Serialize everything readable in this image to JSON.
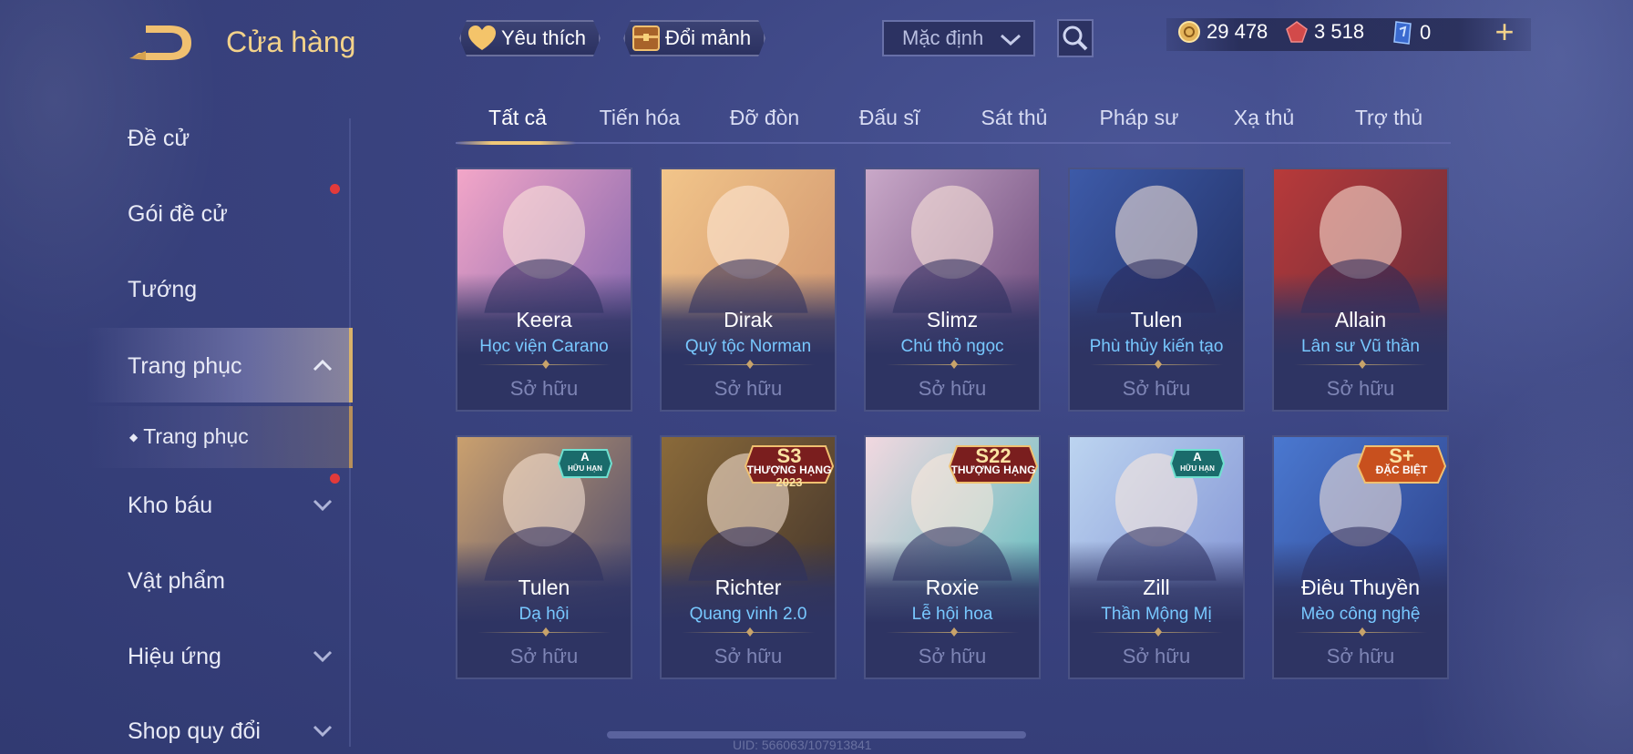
{
  "header": {
    "title": "Cửa hàng",
    "favorites_label": "Yêu thích",
    "exchange_label": "Đổi mảnh",
    "sort_value": "Mặc định",
    "currencies": [
      {
        "icon": "gold-coin-icon",
        "value": "29 478"
      },
      {
        "icon": "red-gem-icon",
        "value": "3 518"
      },
      {
        "icon": "blue-card-icon",
        "value": "0"
      }
    ],
    "plus_label": "+"
  },
  "sidebar": {
    "items": [
      {
        "label": "Đề cử"
      },
      {
        "label": "Gói đề cử"
      },
      {
        "label": "Tướng"
      },
      {
        "label": "Trang phục"
      },
      {
        "label": "Trang phục"
      },
      {
        "label": "Kho báu"
      },
      {
        "label": "Vật phẩm"
      },
      {
        "label": "Hiệu ứng"
      },
      {
        "label": "Shop quy đổi"
      }
    ]
  },
  "tabs": [
    "Tất cả",
    "Tiến hóa",
    "Đỡ đòn",
    "Đấu sĩ",
    "Sát thủ",
    "Pháp sư",
    "Xạ thủ",
    "Trợ thủ"
  ],
  "owned_label": "Sở hữu",
  "cards": [
    {
      "hero": "Keera",
      "skin": "Học viện Carano",
      "palette": [
        "#f3a6c8",
        "#6e5aa8"
      ]
    },
    {
      "hero": "Dirak",
      "skin": "Quý tộc Norman",
      "palette": [
        "#f2c58a",
        "#c98c6a"
      ]
    },
    {
      "hero": "Slimz",
      "skin": "Chú thỏ ngọc",
      "palette": [
        "#c9a8c8",
        "#5c3a6e"
      ]
    },
    {
      "hero": "Tulen",
      "skin": "Phù thủy kiến tạo",
      "palette": [
        "#3d5aa8",
        "#1e2a5a"
      ]
    },
    {
      "hero": "Allain",
      "skin": "Lân sư Vũ thần",
      "palette": [
        "#b83a3a",
        "#5a2a3a"
      ]
    },
    {
      "hero": "Tulen",
      "skin": "Dạ hội",
      "palette": [
        "#caa06e",
        "#3a3e6e"
      ],
      "badge": {
        "top": "A",
        "bottom": "HỮU HẠN"
      }
    },
    {
      "hero": "Richter",
      "skin": "Quang vinh 2.0",
      "palette": [
        "#8a6a3a",
        "#3a2e2a"
      ],
      "badge": {
        "top": "S3",
        "bottom": "THƯỢNG HẠNG",
        "extra": "2023"
      }
    },
    {
      "hero": "Roxie",
      "skin": "Lễ hội hoa",
      "palette": [
        "#f2d8e0",
        "#4ab8b8"
      ],
      "badge": {
        "top": "S22",
        "bottom": "THƯỢNG HẠNG"
      }
    },
    {
      "hero": "Zill",
      "skin": "Thần Mộng Mị",
      "palette": [
        "#bcd4f0",
        "#7a8ad0"
      ],
      "badge": {
        "top": "A",
        "bottom": "HỮU HẠN"
      }
    },
    {
      "hero": "Điêu Thuyền",
      "skin": "Mèo công nghệ",
      "palette": [
        "#4a78d0",
        "#2a3a80"
      ],
      "badge": {
        "top": "S+",
        "bottom": "ĐẶC BIỆT"
      }
    }
  ],
  "uid_text": "UID: 566063/107913841",
  "colors": {
    "accent_gold": "#f3d28a",
    "skin_blue": "#78c8ff",
    "notify_red": "#e23a3a"
  }
}
